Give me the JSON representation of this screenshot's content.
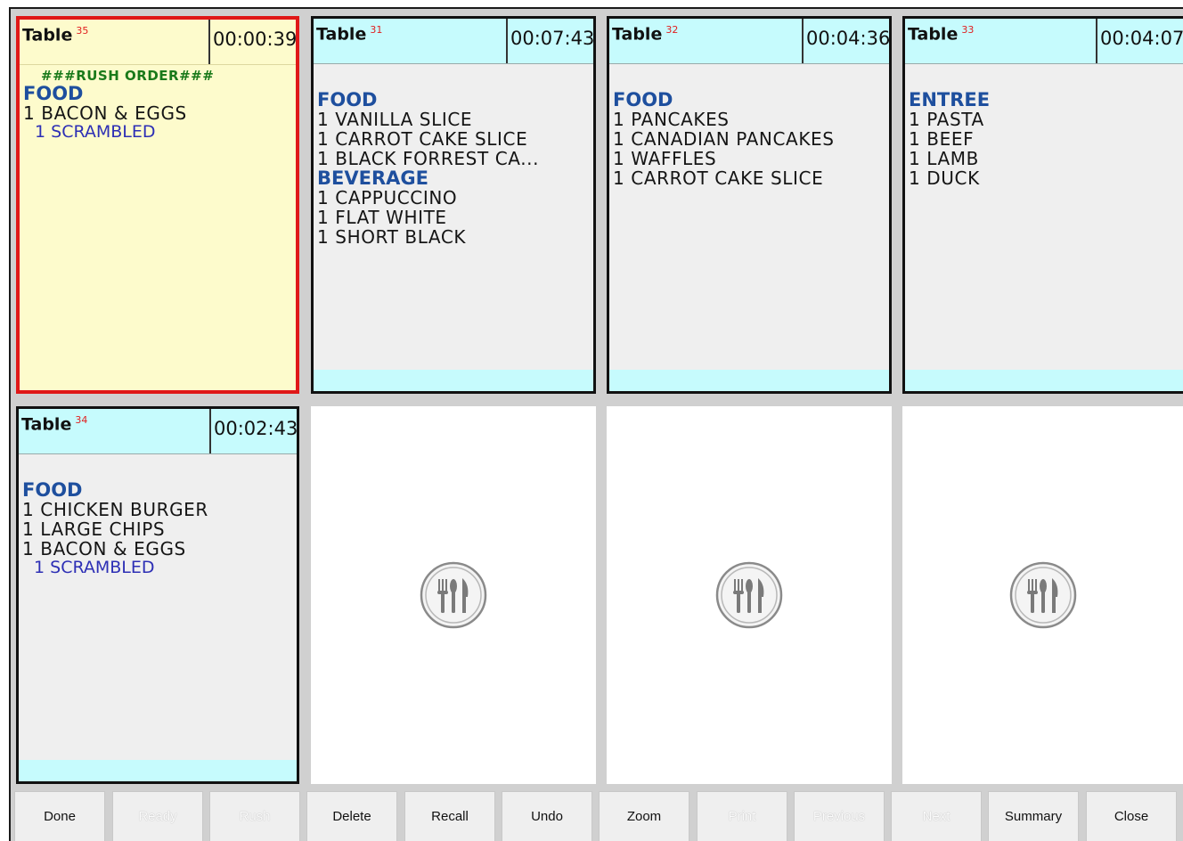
{
  "table_word": "Table",
  "tickets": [
    {
      "table_number": "35",
      "timer": "00:00:39",
      "rush": true,
      "rush_text": "###RUSH ORDER###",
      "sections": [
        {
          "category": "FOOD",
          "lines": [
            {
              "kind": "item",
              "text": "1 BACON & EGGS"
            },
            {
              "kind": "mod",
              "text": "1 SCRAMBLED"
            }
          ]
        }
      ]
    },
    {
      "table_number": "31",
      "timer": "00:07:43",
      "rush": false,
      "sections": [
        {
          "category": "FOOD",
          "lines": [
            {
              "kind": "item",
              "text": "1 VANILLA SLICE"
            },
            {
              "kind": "item",
              "text": "1 CARROT CAKE SLICE"
            },
            {
              "kind": "item",
              "text": "1 BLACK FORREST CA..."
            }
          ]
        },
        {
          "category": "BEVERAGE",
          "lines": [
            {
              "kind": "item",
              "text": "1 CAPPUCCINO"
            },
            {
              "kind": "item",
              "text": "1 FLAT WHITE"
            },
            {
              "kind": "item",
              "text": "1 SHORT BLACK"
            }
          ]
        }
      ]
    },
    {
      "table_number": "32",
      "timer": "00:04:36",
      "rush": false,
      "sections": [
        {
          "category": "FOOD",
          "lines": [
            {
              "kind": "item",
              "text": "1 PANCAKES"
            },
            {
              "kind": "item",
              "text": "1 CANADIAN PANCAKES"
            },
            {
              "kind": "item",
              "text": "1 WAFFLES"
            },
            {
              "kind": "item",
              "text": "1 CARROT CAKE SLICE"
            }
          ]
        }
      ]
    },
    {
      "table_number": "33",
      "timer": "00:04:07",
      "rush": false,
      "sections": [
        {
          "category": "ENTREE",
          "lines": [
            {
              "kind": "item",
              "text": "1 PASTA"
            },
            {
              "kind": "item",
              "text": "1 BEEF"
            },
            {
              "kind": "item",
              "text": "1 LAMB"
            },
            {
              "kind": "item",
              "text": "1 DUCK"
            }
          ]
        }
      ]
    },
    {
      "table_number": "34",
      "timer": "00:02:43",
      "rush": false,
      "sections": [
        {
          "category": "FOOD",
          "lines": [
            {
              "kind": "item",
              "text": "1 CHICKEN BURGER"
            },
            {
              "kind": "item",
              "text": "1 LARGE CHIPS"
            },
            {
              "kind": "item",
              "text": "1 BACON & EGGS"
            },
            {
              "kind": "mod",
              "text": "1 SCRAMBLED"
            }
          ]
        }
      ]
    }
  ],
  "empty_slot_icon": "cutlery-plate-icon",
  "toolbar": [
    {
      "name": "done",
      "label": "Done",
      "enabled": true
    },
    {
      "name": "ready",
      "label": "Ready",
      "enabled": false
    },
    {
      "name": "rush",
      "label": "Rush",
      "enabled": false
    },
    {
      "name": "delete",
      "label": "Delete",
      "enabled": true
    },
    {
      "name": "recall",
      "label": "Recall",
      "enabled": true
    },
    {
      "name": "undo",
      "label": "Undo",
      "enabled": true
    },
    {
      "name": "zoom",
      "label": "Zoom",
      "enabled": true
    },
    {
      "name": "print",
      "label": "Print",
      "enabled": false
    },
    {
      "name": "previous",
      "label": "Previous",
      "enabled": false
    },
    {
      "name": "next",
      "label": "Next",
      "enabled": false
    },
    {
      "name": "summary",
      "label": "Summary",
      "enabled": true
    },
    {
      "name": "close",
      "label": "Close",
      "enabled": true
    }
  ],
  "colors": {
    "rush_border": "#e01818",
    "header_cyan": "#c6fbfd",
    "category_blue": "#1e4f9e",
    "modifier_blue": "#2d2fb5",
    "table_number_red": "#e02020",
    "rush_green": "#1a7a1a"
  }
}
